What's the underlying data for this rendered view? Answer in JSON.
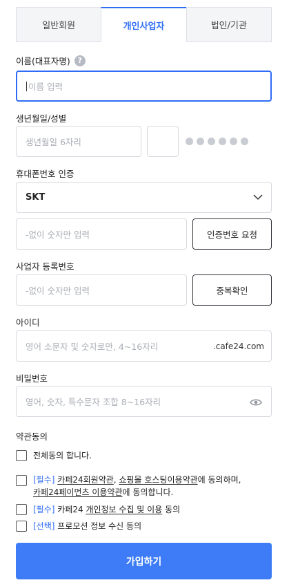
{
  "tabs": [
    {
      "label": "일반회원",
      "active": false
    },
    {
      "label": "개인사업자",
      "active": true
    },
    {
      "label": "법인/기관",
      "active": false
    }
  ],
  "name": {
    "label": "이름(대표자명)",
    "help": "?",
    "placeholder": "이름 입력"
  },
  "birth": {
    "label": "생년월일/성별",
    "placeholder": "생년월일 6자리"
  },
  "phone": {
    "label": "휴대폰번호 인증",
    "carrier": "SKT",
    "placeholder": "-없이 숫자만 입력",
    "request_button": "인증번호 요청"
  },
  "biz": {
    "label": "사업자 등록번호",
    "placeholder": "-없이 숫자만 입력",
    "check_button": "중복확인"
  },
  "userid": {
    "label": "아이디",
    "placeholder": "영어 소문자 및 숫자로만, 4~16자리",
    "suffix": ".cafe24.com"
  },
  "password": {
    "label": "비밀번호",
    "placeholder": "영어, 숫자, 특수문자 조합 8~16자리"
  },
  "terms": {
    "label": "약관동의",
    "all": "전체동의 합니다.",
    "item1": {
      "tag": "[필수]",
      "link1": "카페24회원약관",
      "sep1": ", ",
      "link2": "쇼핑몰 호스팅이용약관",
      "rest1": "에 동의하며,",
      "link3": "카페24페이먼츠 이용약관",
      "rest2": "에 동의합니다."
    },
    "item2": {
      "tag": "[필수]",
      "pre": " 카페24 ",
      "link": "개인정보 수집 및 이용",
      "post": " 동의"
    },
    "item3": {
      "tag": "[선택]",
      "text": " 프로모션 정보 수신 동의"
    }
  },
  "submit": "가입하기",
  "colors": {
    "accent": "#2e6cf6",
    "submit": "#3d7cf6"
  }
}
